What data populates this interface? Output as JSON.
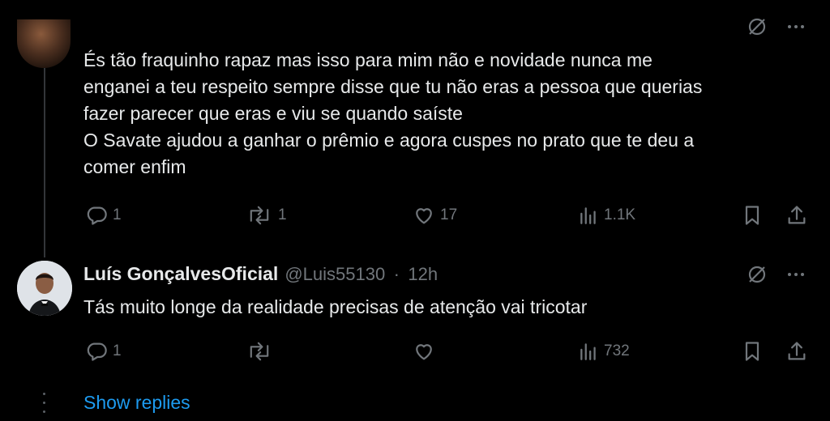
{
  "tweet1": {
    "text": "És tão fraquinho rapaz mas isso para mim não e novidade nunca me\nenganei a teu respeito sempre disse que tu não eras a pessoa que querias\nfazer parecer que eras e viu se quando saíste\nO Savate ajudou a ganhar o prêmio e agora cuspes no prato que te deu a\ncomer enfim",
    "replies": "1",
    "retweets": "1",
    "likes": "17",
    "views": "1.1K"
  },
  "tweet2": {
    "author_name": "Luís GonçalvesOficial",
    "handle": "@Luis55130",
    "separator": "·",
    "time": "12h",
    "text": "Tás muito longe da realidade precisas de atenção vai tricotar",
    "replies": "1",
    "views": "732"
  },
  "show_replies": "Show replies",
  "colors": {
    "accent": "#1d9bf0",
    "muted": "#71767b",
    "text": "#e7e9ea",
    "bg": "#000000"
  },
  "icons": [
    "grok-icon",
    "more-icon",
    "reply-icon",
    "retweet-icon",
    "like-icon",
    "views-icon",
    "bookmark-icon",
    "share-icon"
  ]
}
